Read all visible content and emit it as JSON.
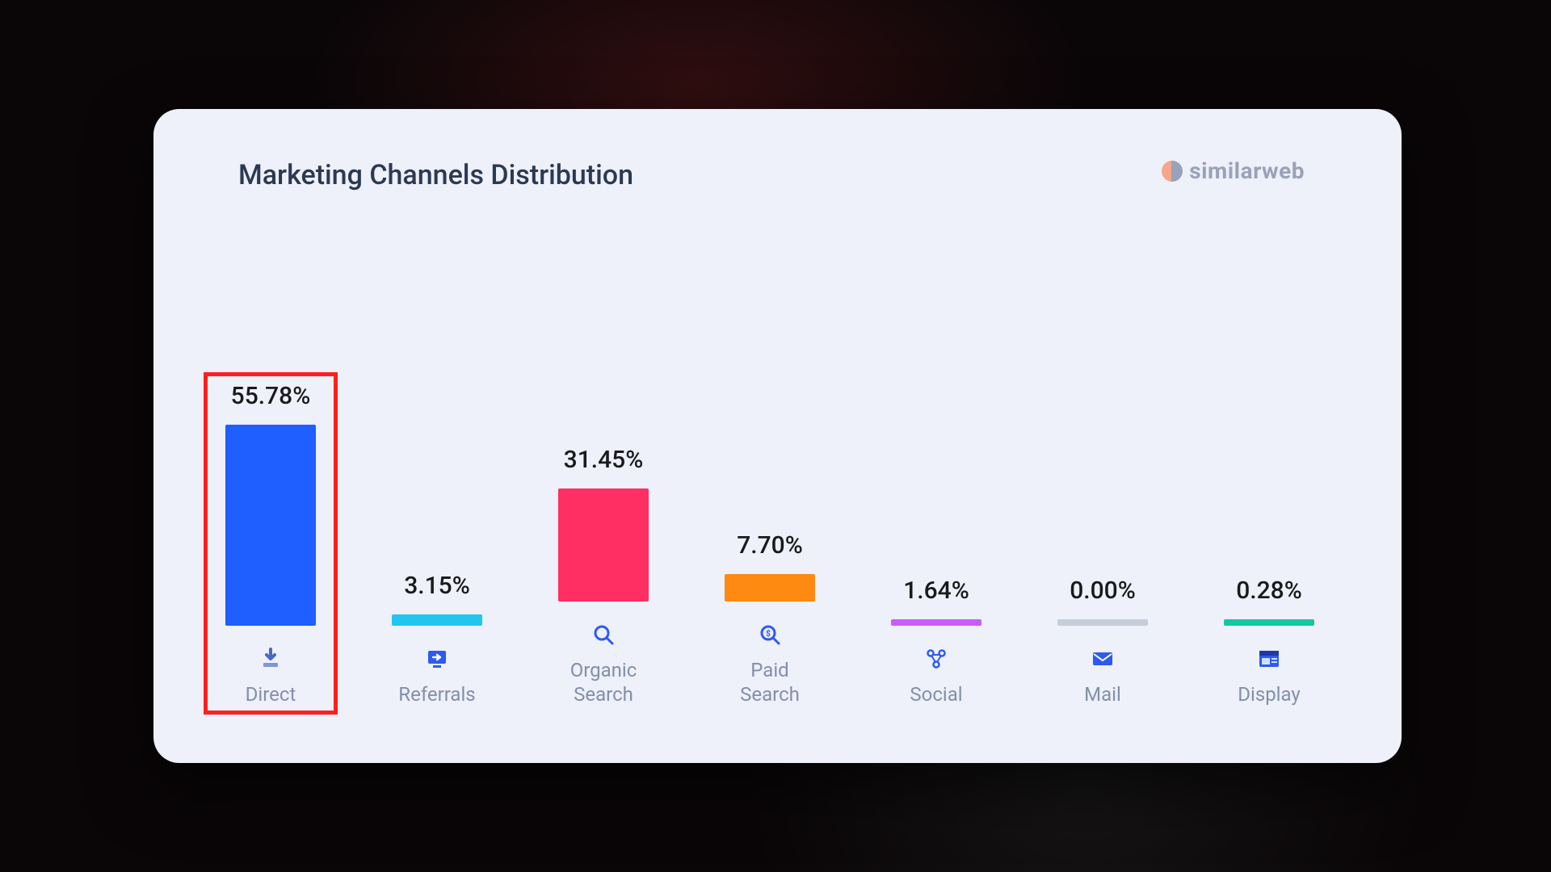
{
  "title": "Marketing Channels Distribution",
  "brand": "similarweb",
  "highlight_index": 0,
  "ylim_max": 56,
  "chart_data": {
    "type": "bar",
    "title": "Marketing Channels Distribution",
    "xlabel": "",
    "ylabel": "",
    "ylim": [
      0,
      60
    ],
    "categories": [
      "Direct",
      "Referrals",
      "Organic Search",
      "Paid Search",
      "Social",
      "Mail",
      "Display"
    ],
    "values": [
      55.78,
      3.15,
      31.45,
      7.7,
      1.64,
      0.0,
      0.28
    ],
    "value_labels": [
      "55.78%",
      "3.15%",
      "31.45%",
      "7.70%",
      "1.64%",
      "0.00%",
      "0.28%"
    ],
    "colors": [
      "#1f5eff",
      "#23c4ee",
      "#ff2e63",
      "#ff8a12",
      "#c95bff",
      "#c7ccda",
      "#14c7a0"
    ],
    "icons": [
      "direct",
      "referrals",
      "organic-search",
      "paid-search",
      "social",
      "mail",
      "display"
    ]
  }
}
